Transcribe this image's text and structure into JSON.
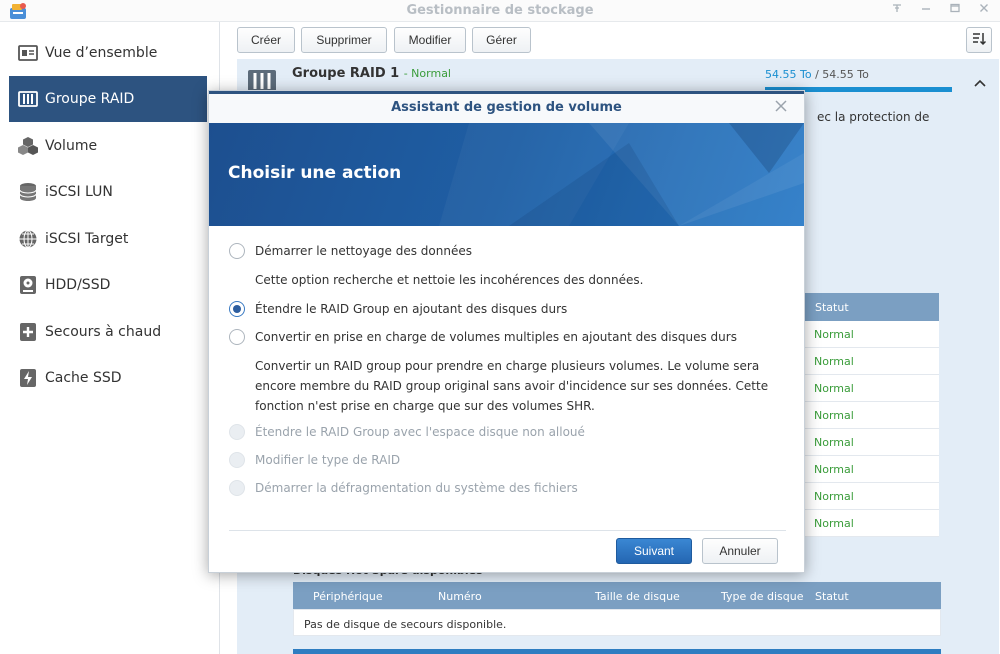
{
  "window": {
    "title": "Gestionnaire de stockage",
    "controls": [
      "pin-icon",
      "minimize-icon",
      "maximize-icon",
      "close-icon"
    ]
  },
  "sidebar": {
    "items": [
      {
        "label": "Vue d’ensemble",
        "icon": "overview-icon",
        "active": false
      },
      {
        "label": "Groupe RAID",
        "icon": "raid-icon",
        "active": true
      },
      {
        "label": "Volume",
        "icon": "volume-cubes-icon",
        "active": false
      },
      {
        "label": "iSCSI LUN",
        "icon": "database-icon",
        "active": false
      },
      {
        "label": "iSCSI Target",
        "icon": "globe-icon",
        "active": false
      },
      {
        "label": "HDD/SSD",
        "icon": "hdd-icon",
        "active": false
      },
      {
        "label": "Secours à chaud",
        "icon": "hot-spare-plus-icon",
        "active": false
      },
      {
        "label": "Cache SSD",
        "icon": "ssd-cache-icon",
        "active": false
      }
    ]
  },
  "toolbar": {
    "create": "Créer",
    "delete": "Supprimer",
    "modify": "Modifier",
    "manage": "Gérer"
  },
  "raid": {
    "title": "Groupe RAID 1",
    "status": "- Normal",
    "used": "54.55 To",
    "total": " / 54.55 To",
    "usage_fraction": 1.0,
    "desc_fragment": "ec la protection de",
    "disk_status_header": "Statut",
    "disk_statuses": [
      "Normal",
      "Normal",
      "Normal",
      "Normal",
      "Normal",
      "Normal",
      "Normal",
      "Normal"
    ],
    "hot_spare_heading": "Disques Hot Spare disponibles",
    "hot_spare_columns": [
      "Périphérique",
      "Numéro",
      "Taille de disque",
      "Type de disque",
      "Statut"
    ],
    "hot_spare_empty": "Pas de disque de secours disponible."
  },
  "modal": {
    "title": "Assistant de gestion de volume",
    "banner_title": "Choisir une action",
    "options": [
      {
        "label": "Démarrer le nettoyage des données",
        "checked": false,
        "disabled": false
      },
      {
        "label": "Étendre le RAID Group en ajoutant des disques durs",
        "checked": true,
        "disabled": false
      },
      {
        "label": "Convertir en prise en charge de volumes multiples en ajoutant des disques durs",
        "checked": false,
        "disabled": false
      },
      {
        "label": "Étendre le RAID Group avec l'espace disque non alloué",
        "checked": false,
        "disabled": true
      },
      {
        "label": "Modifier le type de RAID",
        "checked": false,
        "disabled": true
      },
      {
        "label": "Démarrer la défragmentation du système des fichiers",
        "checked": false,
        "disabled": true
      }
    ],
    "desc_scrub": "Cette option recherche et nettoie les incohérences des données.",
    "desc_convert": "Convertir un RAID group pour prendre en charge plusieurs volumes. Le volume sera encore membre du RAID group original sans avoir d'incidence sur ses données. Cette fonction n'est prise en charge que sur des volumes SHR.",
    "next": "Suivant",
    "cancel": "Annuler"
  },
  "colors": {
    "accent": "#2d5380",
    "status_ok": "#3a9c3a",
    "table_header": "#7b9fc2"
  }
}
